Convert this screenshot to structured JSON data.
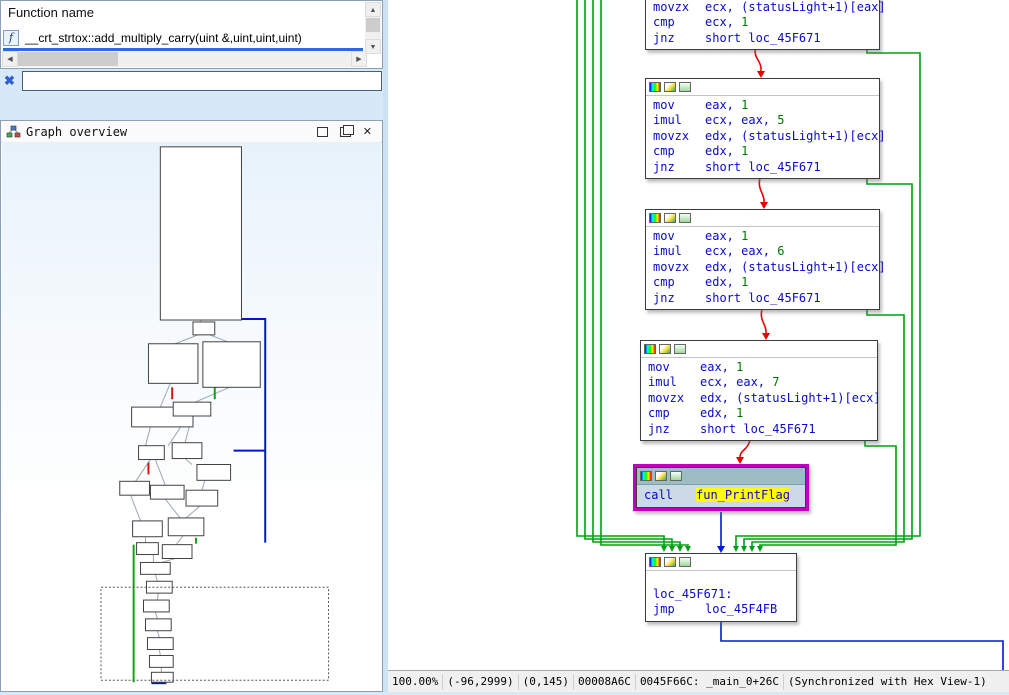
{
  "left": {
    "function_list": {
      "header": "Function name",
      "rows": [
        {
          "name": "__crt_strtox::add_multiply_carry(uint &,uint,uint,uint)"
        }
      ]
    },
    "filter": {
      "value": "",
      "placeholder": ""
    },
    "overview": {
      "title": "Graph overview"
    }
  },
  "icons": {
    "function_f": "f",
    "clear_filter": "✖",
    "close": "✕",
    "arrow_up": "▲",
    "arrow_down": "▼",
    "arrow_left": "◀",
    "arrow_right": "▶"
  },
  "graph": {
    "blocks": {
      "b0": {
        "lines": [
          {
            "m": "movzx",
            "o": "ecx, (statusLight+1)[eax]"
          },
          {
            "m": "cmp",
            "o": "ecx, ",
            "n": "1"
          },
          {
            "m": "jnz",
            "o": "short loc_45F671"
          }
        ]
      },
      "b1": {
        "lines": [
          {
            "m": "mov",
            "o": "eax, ",
            "n": "1"
          },
          {
            "m": "imul",
            "o": "ecx, eax, ",
            "n": "5"
          },
          {
            "m": "movzx",
            "o": "edx, (statusLight+1)[ecx]"
          },
          {
            "m": "cmp",
            "o": "edx, ",
            "n": "1"
          },
          {
            "m": "jnz",
            "o": "short loc_45F671"
          }
        ]
      },
      "b2": {
        "lines": [
          {
            "m": "mov",
            "o": "eax, ",
            "n": "1"
          },
          {
            "m": "imul",
            "o": "ecx, eax, ",
            "n": "6"
          },
          {
            "m": "movzx",
            "o": "edx, (statusLight+1)[ecx]"
          },
          {
            "m": "cmp",
            "o": "edx, ",
            "n": "1"
          },
          {
            "m": "jnz",
            "o": "short loc_45F671"
          }
        ]
      },
      "b3": {
        "lines": [
          {
            "m": "mov",
            "o": "eax, ",
            "n": "1"
          },
          {
            "m": "imul",
            "o": "ecx, eax, ",
            "n": "7"
          },
          {
            "m": "movzx",
            "o": "edx, (statusLight+1)[ecx]"
          },
          {
            "m": "cmp",
            "o": "edx, ",
            "n": "1"
          },
          {
            "m": "jnz",
            "o": "short loc_45F671"
          }
        ]
      },
      "b4": {
        "lines": [
          {
            "m": "call",
            "h": "fun_PrintFlag"
          }
        ]
      },
      "b5": {
        "lines": [
          {
            "label": "loc_45F671:"
          },
          {
            "m": "jmp",
            "o": "loc_45F4FB"
          }
        ]
      }
    }
  },
  "status": {
    "zoom": "100.00%",
    "pos": "(-96,2999)",
    "cursor": "(0,145)",
    "file_offset": "00008A6C",
    "address": "0045F66C: _main_0+26C",
    "sync": "(Synchronized with Hex View-1)"
  },
  "colors": {
    "highlight_border": "#bf00bf",
    "identifier_highlight": "#ffff00",
    "edge_jump_taken": "#00a014",
    "edge_jump_not_taken": "#e80000",
    "edge_unconditional": "#0018d8",
    "selection": "#2a6dd8"
  }
}
